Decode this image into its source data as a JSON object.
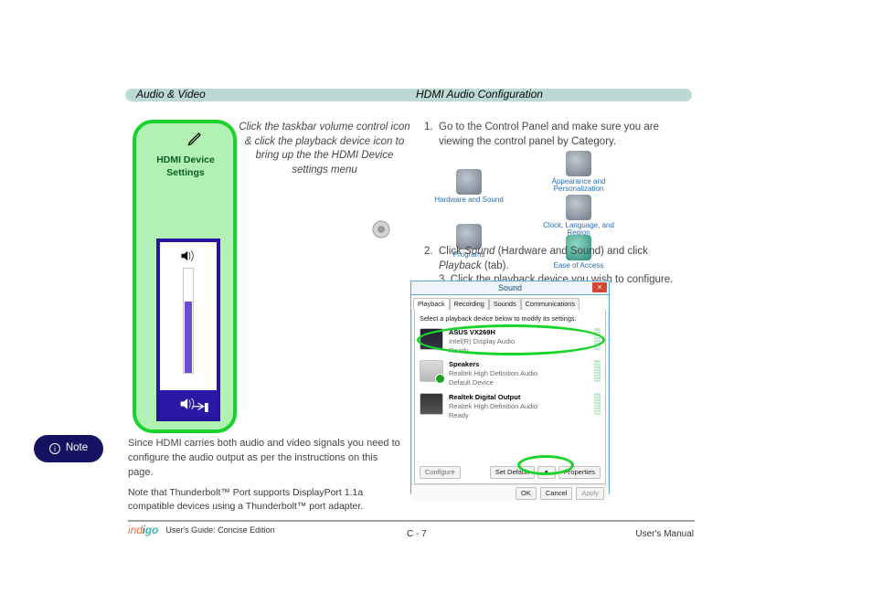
{
  "section": {
    "title": "Audio & Video",
    "subtitle": "HDMI Audio Configuration"
  },
  "hdmi": {
    "settingsLabel": "HDMI Device Settings",
    "externalCaption": "Click the taskbar volume control icon & click the playback device icon to bring up the the HDMI Device settings menu"
  },
  "controlPanelSteps": {
    "step1": "Go to the Control Panel and make sure you are viewing the control panel by Category.",
    "step2Pre": "Click ",
    "step2LinkSound": "Sound",
    "step2Mid": " (Hardware and Sound) and click ",
    "step2LinkPlayback": "Playback",
    "step2Post": " (tab).",
    "step3": " Click the playback device you wish to configure.",
    "cpTiles": {
      "appearance": "Appearance and Personalization",
      "clock": "Clock, Language, and Region",
      "access": "Ease of Access",
      "hardwareSound": "Hardware and Sound",
      "programs": "Programs"
    }
  },
  "note": {
    "label": "Note",
    "text": "Since HDMI carries both audio and video signals you need to configure the audio output as per the instructions on this page.",
    "hint": "Note that Thunderbolt™ Port supports DisplayPort 1.1a compatible devices using a Thunderbolt™ port adapter."
  },
  "soundWindow": {
    "title": "Sound",
    "close": "×",
    "tabs": [
      "Playback",
      "Recording",
      "Sounds",
      "Communications"
    ],
    "hint": "Select a playback device below to modify its settings:",
    "devices": [
      {
        "name": "ASUS VX269H",
        "sub": "Intel(R) Display Audio",
        "status": "Ready"
      },
      {
        "name": "Speakers",
        "sub": "Realtek High Definition Audio",
        "status": "Default Device"
      },
      {
        "name": "Realtek Digital Output",
        "sub": "Realtek High Definition Audio",
        "status": "Ready"
      }
    ],
    "configure": "Configure",
    "setDefault": "Set Default",
    "properties": "Properties",
    "ok": "OK",
    "cancel": "Cancel",
    "apply": "Apply"
  },
  "footer": {
    "brand": "indigo",
    "tag": "User's Guide: Concise Edition",
    "pageNumber": "C - 7",
    "manual": "User's Manual"
  },
  "icons": {
    "pen": "pen-icon",
    "speaker": "speaker-icon"
  }
}
